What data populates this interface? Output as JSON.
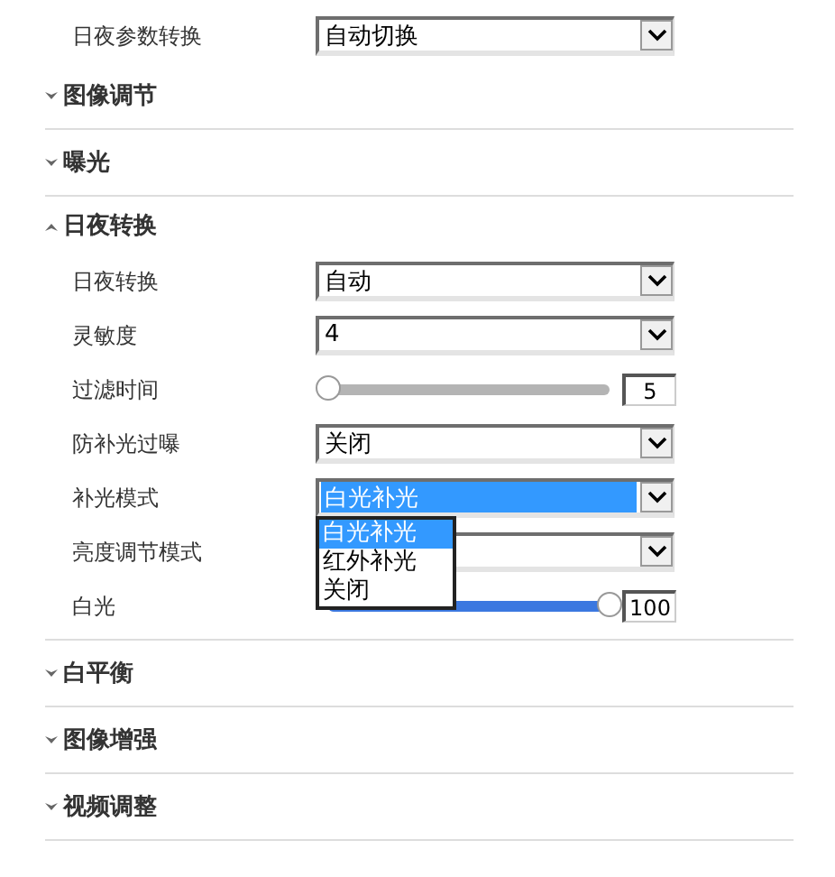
{
  "top_row": {
    "label": "日夜参数转换",
    "value": "自动切换"
  },
  "sections": [
    {
      "title": "图像调节",
      "expanded": false
    },
    {
      "title": "曝光",
      "expanded": false
    },
    {
      "title": "日夜转换",
      "expanded": true,
      "rows": [
        {
          "kind": "select",
          "label": "日夜转换",
          "value": "自动",
          "focused": false
        },
        {
          "kind": "select",
          "label": "灵敏度",
          "value": "4",
          "focused": false
        },
        {
          "kind": "slider",
          "label": "过滤时间",
          "level": 0,
          "reading": "5"
        },
        {
          "kind": "select",
          "label": "防补光过曝",
          "value": "关闭",
          "focused": false
        },
        {
          "kind": "select",
          "label": "补光模式",
          "value": "白光补光",
          "focused": true,
          "open": true,
          "options": [
            {
              "label": "白光补光",
              "selected": true
            },
            {
              "label": "红外补光",
              "selected": false
            },
            {
              "label": "关闭",
              "selected": false
            }
          ]
        },
        {
          "kind": "select",
          "label": "亮度调节模式",
          "focused": false
        },
        {
          "kind": "slider",
          "label": "白光",
          "level": 1,
          "reading": "100"
        }
      ]
    },
    {
      "title": "白平衡",
      "expanded": false
    },
    {
      "title": "图像增强",
      "expanded": false
    },
    {
      "title": "视频调整",
      "expanded": false
    }
  ]
}
